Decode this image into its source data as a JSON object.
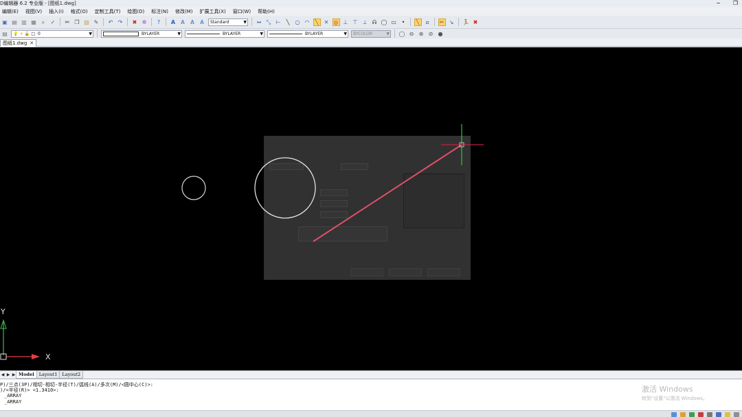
{
  "window": {
    "title": "D编辑器 6.2 专业版 - [图纸1.dwg]",
    "minimize_glyph": "−",
    "restore_glyph": "❐"
  },
  "menu": [
    "编辑(E)",
    "视图(V)",
    "插入(I)",
    "格式(O)",
    "定制工具(T)",
    "绘图(D)",
    "标注(N)",
    "修改(M)",
    "扩展工具(X)",
    "窗口(W)",
    "帮助(H)"
  ],
  "toolbar": {
    "text_style": "Standard",
    "layer_value": "0",
    "color_value": "BYLAYER",
    "linetype_value": "BYLAYER",
    "lineweight_value": "BYLAYER",
    "plotstyle_value": "BYCOLOR"
  },
  "document_tab": {
    "label": "图纸1.dwg",
    "close_glyph": "✕"
  },
  "canvas": {
    "background": "#000000",
    "crosshair_color": "#3fbf3f",
    "rubberband_color": "#e0506a",
    "ucs_y": "Y",
    "ucs_x": "X"
  },
  "layout_tabs": [
    "Model",
    "Layout1",
    "Layout2"
  ],
  "command_lines": [
    "P)/三点(3P)/相切-相切-半径(T)/弧线(A)/多次(M)/<圆中心(C)>:",
    ")/<半径(R)> <1.3410>:",
    "_ARRAY",
    "_ARRAY"
  ],
  "watermark": {
    "line1": "激活 Windows",
    "line2": "转到\"设置\"以激活 Windows。"
  }
}
